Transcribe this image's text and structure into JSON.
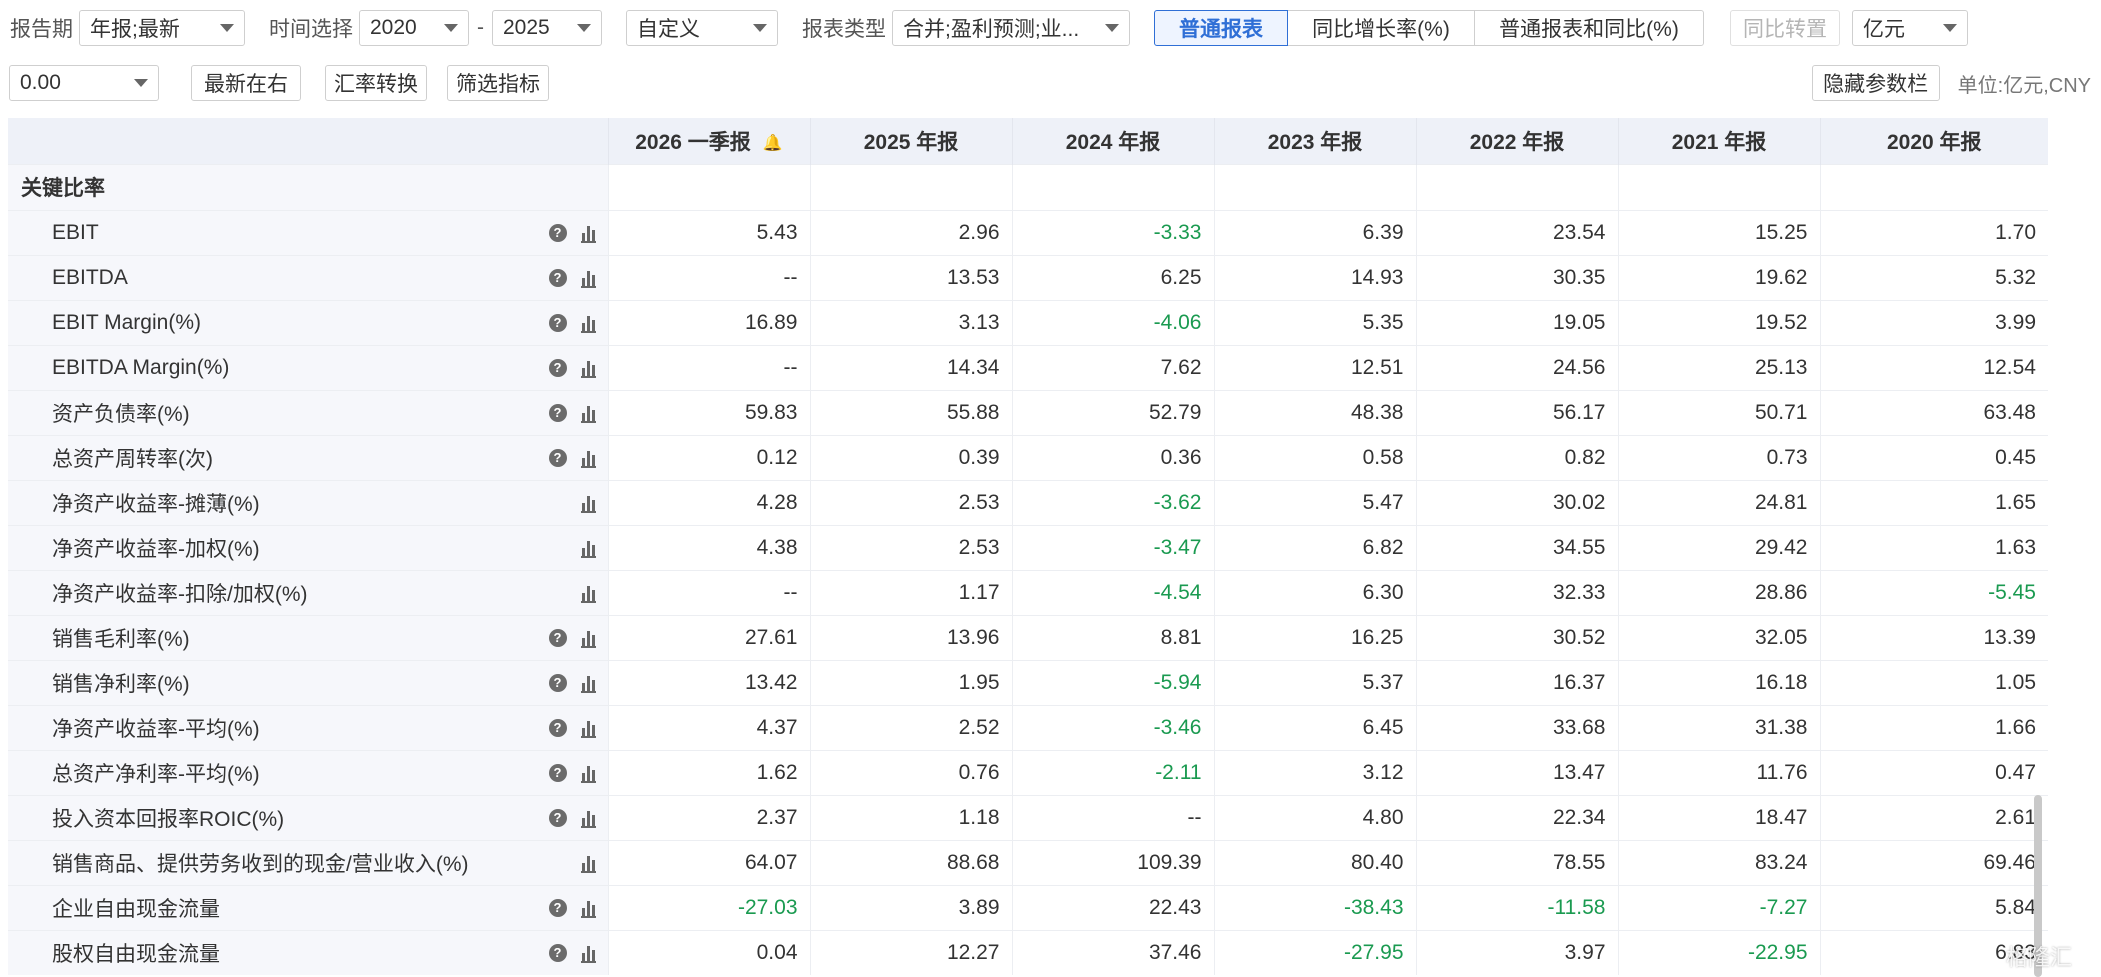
{
  "toolbar": {
    "report_period_label": "报告期",
    "report_period_value": "年报;最新",
    "time_label": "时间选择",
    "time_start": "2020",
    "time_dash": "-",
    "time_end": "2025",
    "custom_value": "自定义",
    "report_type_label": "报表类型",
    "report_type_value": "合并;盈利预测;业...",
    "seg_tabs": [
      "普通报表",
      "同比增长率(%)",
      "普通报表和同比(%)"
    ],
    "yoy_transpose": "同比转置",
    "unit_select": "亿元",
    "decimal_value": "0.00",
    "latest_right": "最新在右",
    "fx_convert": "汇率转换",
    "filter_indicators": "筛选指标",
    "hide_params": "隐藏参数栏",
    "unit_text": "单位:亿元,CNY"
  },
  "table": {
    "columns": [
      "2026 一季报",
      "2025 年报",
      "2024 年报",
      "2023 年报",
      "2022 年报",
      "2021 年报",
      "2020 年报"
    ],
    "section_title": "关键比率",
    "rows": [
      {
        "name": "EBIT",
        "help": true,
        "values": [
          "5.43",
          "2.96",
          "-3.33",
          "6.39",
          "23.54",
          "15.25",
          "1.70"
        ]
      },
      {
        "name": "EBITDA",
        "help": true,
        "values": [
          "--",
          "13.53",
          "6.25",
          "14.93",
          "30.35",
          "19.62",
          "5.32"
        ]
      },
      {
        "name": "EBIT Margin(%)",
        "help": true,
        "values": [
          "16.89",
          "3.13",
          "-4.06",
          "5.35",
          "19.05",
          "19.52",
          "3.99"
        ]
      },
      {
        "name": "EBITDA Margin(%)",
        "help": true,
        "values": [
          "--",
          "14.34",
          "7.62",
          "12.51",
          "24.56",
          "25.13",
          "12.54"
        ]
      },
      {
        "name": "资产负债率(%)",
        "help": true,
        "values": [
          "59.83",
          "55.88",
          "52.79",
          "48.38",
          "56.17",
          "50.71",
          "63.48"
        ]
      },
      {
        "name": "总资产周转率(次)",
        "help": true,
        "values": [
          "0.12",
          "0.39",
          "0.36",
          "0.58",
          "0.82",
          "0.73",
          "0.45"
        ]
      },
      {
        "name": "净资产收益率-摊薄(%)",
        "help": false,
        "values": [
          "4.28",
          "2.53",
          "-3.62",
          "5.47",
          "30.02",
          "24.81",
          "1.65"
        ]
      },
      {
        "name": "净资产收益率-加权(%)",
        "help": false,
        "values": [
          "4.38",
          "2.53",
          "-3.47",
          "6.82",
          "34.55",
          "29.42",
          "1.63"
        ]
      },
      {
        "name": "净资产收益率-扣除/加权(%)",
        "help": false,
        "values": [
          "--",
          "1.17",
          "-4.54",
          "6.30",
          "32.33",
          "28.86",
          "-5.45"
        ]
      },
      {
        "name": "销售毛利率(%)",
        "help": true,
        "values": [
          "27.61",
          "13.96",
          "8.81",
          "16.25",
          "30.52",
          "32.05",
          "13.39"
        ]
      },
      {
        "name": "销售净利率(%)",
        "help": true,
        "values": [
          "13.42",
          "1.95",
          "-5.94",
          "5.37",
          "16.37",
          "16.18",
          "1.05"
        ]
      },
      {
        "name": "净资产收益率-平均(%)",
        "help": true,
        "values": [
          "4.37",
          "2.52",
          "-3.46",
          "6.45",
          "33.68",
          "31.38",
          "1.66"
        ]
      },
      {
        "name": "总资产净利率-平均(%)",
        "help": true,
        "values": [
          "1.62",
          "0.76",
          "-2.11",
          "3.12",
          "13.47",
          "11.76",
          "0.47"
        ]
      },
      {
        "name": "投入资本回报率ROIC(%)",
        "help": true,
        "values": [
          "2.37",
          "1.18",
          "--",
          "4.80",
          "22.34",
          "18.47",
          "2.61"
        ]
      },
      {
        "name": "销售商品、提供劳务收到的现金/营业收入(%)",
        "help": false,
        "values": [
          "64.07",
          "88.68",
          "109.39",
          "80.40",
          "78.55",
          "83.24",
          "69.46"
        ]
      },
      {
        "name": "企业自由现金流量",
        "help": true,
        "values": [
          "-27.03",
          "3.89",
          "22.43",
          "-38.43",
          "-11.58",
          "-7.27",
          "5.84"
        ]
      },
      {
        "name": "股权自由现金流量",
        "help": true,
        "values": [
          "0.04",
          "12.27",
          "37.46",
          "-27.95",
          "3.97",
          "-22.95",
          "6.83"
        ]
      }
    ]
  },
  "watermark": "格隆汇",
  "colors": {
    "accent": "#2f6fd6",
    "negative": "#1a9a50",
    "header_bg": "#eef1f8",
    "bell": "#e04848"
  }
}
